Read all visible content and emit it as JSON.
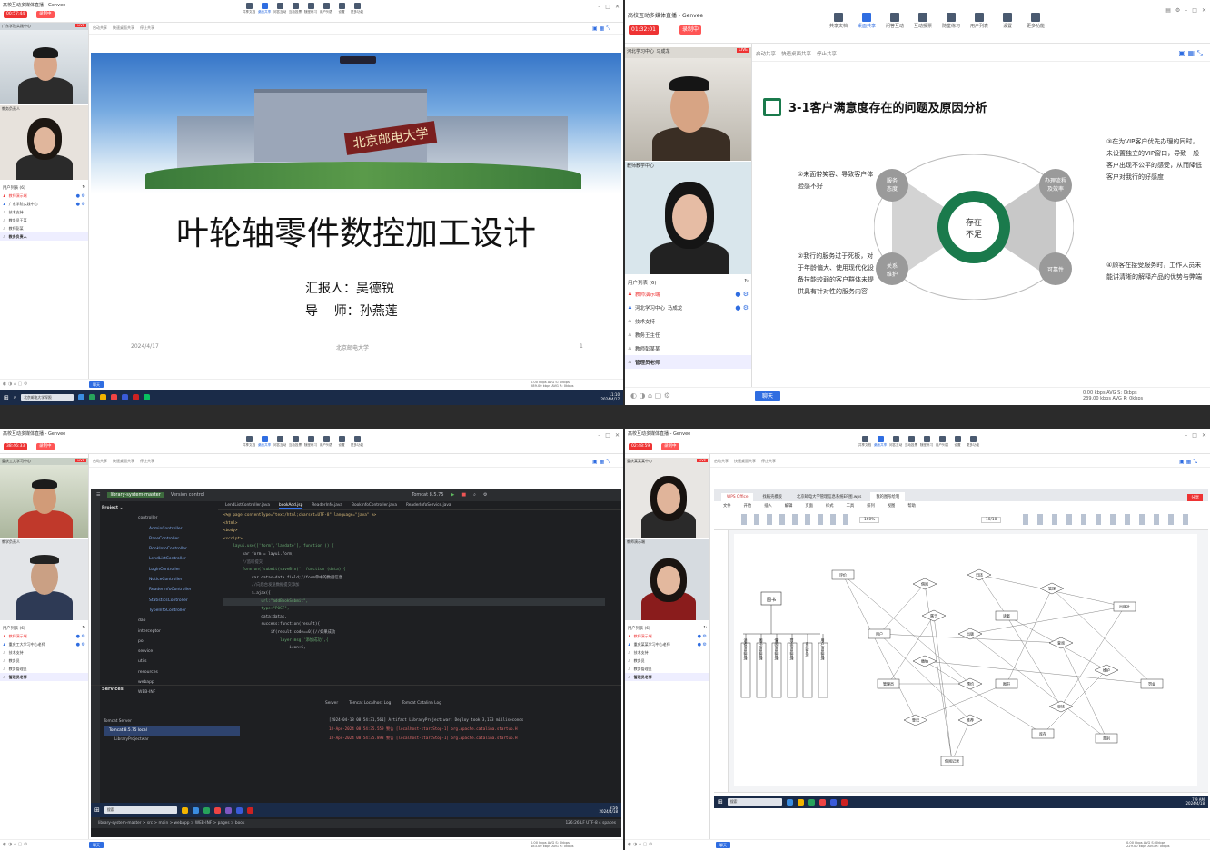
{
  "app": {
    "title": "高校互动多媒体直播 - Genvee",
    "tools": [
      "共享文档",
      "桌面共享",
      "问答互动",
      "互动投票",
      "随堂练习",
      "用户列表",
      "设置",
      "更多功能"
    ],
    "share_tabs": [
      "启动共享",
      "快速桌面共享",
      "停止共享"
    ]
  },
  "q1": {
    "rec": "00:57:44",
    "btn2": "录制中",
    "cams": [
      {
        "label": "广东学院实践中心"
      },
      {
        "label": "教务负责人"
      }
    ],
    "users_header": "用户列表 (6)",
    "users": [
      "教师演示端",
      "广东学院实践中心",
      "技术支持",
      "教务员王某",
      "教师彭某",
      "教务负责人"
    ],
    "slide": {
      "title": "叶轮轴零件数控加工设计",
      "reporter": "汇报人：吴德锐",
      "advisor": "导    师：孙燕莲",
      "date": "2024/4/17",
      "org": "北京邮电大学",
      "page": "1",
      "banner": "北京邮电大学"
    },
    "chat": "聊天",
    "stats": [
      "0.00 kbps  AVG S: 0kbps",
      "289.00 kbps AVG R: 0kbps"
    ],
    "taskbar_search": "北京邮电大学探照",
    "clock": [
      "11:10",
      "2024/4/17"
    ]
  },
  "q2": {
    "rec": "01:32:01",
    "btn2": "录制中",
    "cams": [
      {
        "label": "河北学习中心_马成龙"
      },
      {
        "label": "教师教学中心"
      }
    ],
    "users_header": "用户列表 (6)",
    "users": [
      "教师演示端",
      "河北学习中心_马成龙",
      "技术支持",
      "教务王主任",
      "教师彭某某",
      "管理员老师"
    ],
    "slide": {
      "heading": "3-1客户满意度存在的问题及原因分析",
      "center": "存在\n不足",
      "nodes": [
        "服务\n态度",
        "办理流程\n及效率",
        "关系\n维护",
        "可靠性"
      ],
      "t1": "①未面带笑容、导致客户体验感不好",
      "t2": "②我行的服务过于死板，对于年龄偏大、使用现代化设备技能较弱的客户群体未提供具有针对性的服务内容",
      "t3": "③在为VIP客户优先办理的同时，未设置独立的VIP窗口，导致一般客户出现不公平的感受，从而降低客户对我行的好感度",
      "t4": "④顾客在接受服务时，工作人员未能讲清晰的解释产品的优势与弊端"
    },
    "chat": "聊天",
    "stats": [
      "0.00 kbps  AVG S: 0kbps",
      "239.00 kbps AVG R: 0kbps"
    ]
  },
  "q3": {
    "rec": "38:46:33",
    "btn2": "录制中",
    "cams": [
      {
        "label": "重庆工大学习中心"
      },
      {
        "label": "教学负责人"
      }
    ],
    "users_header": "用户列表 (6)",
    "users": [
      "教师演示端",
      "重庆工大学习中心老师",
      "技术支持",
      "教务员",
      "教务管理员",
      "管理员老师"
    ],
    "ide": {
      "project": "library-system-master",
      "vcs": "Version control",
      "run": "Tomcat 8.5.75",
      "tabs": [
        "LendListController.java",
        "bookAdd.jsp",
        "ReaderInfo.java",
        "BookInfoController.java",
        "ReaderInfoService.java"
      ],
      "tree": [
        "controller",
        "AdminController",
        "BaseController",
        "BookInfoController",
        "LendListController",
        "LoginController",
        "NoticeController",
        "ReaderInfoController",
        "StatisticsController",
        "TypeInfoController",
        "dao",
        "interceptor",
        "po",
        "service",
        "utils",
        "resources",
        "webapp",
        "WEB-INF"
      ],
      "code": [
        "<%@ page contentType=\"text/html;charset=UTF-8\" language=\"java\" %>",
        "<html>",
        "<body>",
        "<script>",
        "    layui.use(['form','laydate'], function () {",
        "        var form = layui.form;",
        "",
        "        //监听提交",
        "        form.on('submit(saveBtn)', function (data) {",
        "            var datas=data.field;//form单中的数据信息",
        "            //向后台发送数据提交添加",
        "            $.ajax({",
        "                url:\"addBookSubmit\",",
        "                type:\"POST\",",
        "                data:datas,",
        "                success:function(result){",
        "                    if(result.code==0){//如果成功",
        "                        layer.msg('添加成功',{",
        "                            icon:6,"
      ],
      "services_title": "Services",
      "services": [
        "Tomcat Server",
        "Tomcat 8.5.75 local",
        "LibraryProjectwar"
      ],
      "log": [
        "[2024-04-18 08:54:31,561] Artifact LibraryProject:war: Deploy took 3,173 milliseconds",
        "18-Apr-2024 08:54:35.559 警告 [localhost-startStop-1] org.apache.catalina.startup.H",
        "18-Apr-2024 08:54:35.893 警告 [localhost-startStop-1] org.apache.catalina.startup.H"
      ],
      "log_tabs": [
        "Server",
        "Tomcat Localhost Log",
        "Tomcat Catalina Log"
      ],
      "breadcrumb": "library-system-master > src > main > webapp > WEB-INF > pages > book",
      "status": "126:26  LF  UTF-8  4 spaces"
    },
    "taskbar_search": "搜索",
    "clock": [
      "8:56",
      "2024/4/18"
    ],
    "chat": "聊天",
    "stats": [
      "0.00 kbps  AVG S: 0kbps",
      "183.00 kbps AVG R: 0kbps"
    ]
  },
  "q4": {
    "rec": "02:48:59",
    "btn2": "录制中",
    "cams": [
      {
        "label": "重庆某某某中心"
      },
      {
        "label": "教师演示端"
      }
    ],
    "users_header": "用户列表 (6)",
    "users": [
      "教师演示端",
      "重庆某某学习中心老师",
      "技术支持",
      "教务员",
      "教务管理员",
      "管理员老师"
    ],
    "wps": {
      "tabs": [
        "WPS Office",
        "找稻壳模板",
        "北京邮电大学管理信息系统ER图.wps",
        "我的图形绘制"
      ],
      "menu": [
        "文件",
        "开始",
        "插入",
        "编辑",
        "页面",
        "样式",
        "工具",
        "排列",
        "视图",
        "帮助"
      ],
      "zoom": "160%",
      "page": "10/10",
      "root": "图书",
      "subs": [
        "读者信息管理",
        "图书信息管理",
        "借阅信息管理",
        "罚金信息管理",
        "系统管理",
        "用户信息管理"
      ],
      "entities": [
        "用户",
        "读者",
        "图书",
        "借阅记录",
        "出版社",
        "罚金",
        "管理员",
        "类别",
        "库存",
        "评价"
      ],
      "relations": [
        "借阅",
        "归还",
        "管理",
        "属于",
        "出版",
        "缴纳",
        "预约",
        "查询",
        "维护",
        "登记",
        "推荐",
        "审核"
      ]
    },
    "taskbar_search": "搜索",
    "clock": [
      "7:9 AM",
      "2024/4/18"
    ],
    "chat": "聊天",
    "stats": [
      "0.00 kbps  AVG S: 0kbps",
      "229.00 kbps AVG R: 0kbps"
    ]
  },
  "colors": {
    "accent": "#2f6de1",
    "rec": "#e33333",
    "taskbar": "#1a2b48",
    "ide_bg": "#1e1f22",
    "ppt_green": "#1a7a4c"
  }
}
